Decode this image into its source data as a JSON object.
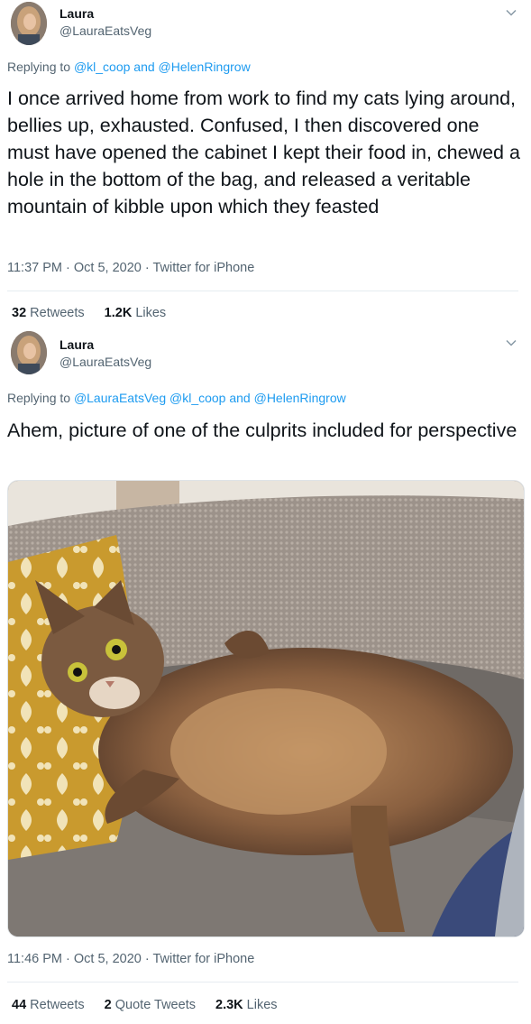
{
  "tweets": [
    {
      "name": "Laura",
      "handle": "@LauraEatsVeg",
      "reply_prefix": "Replying to",
      "reply_mentions": "@kl_coop and @HelenRingrow",
      "text": "I once arrived home from work to find my cats lying around, bellies up, exhausted. Confused, I then discovered one must have opened the cabinet I kept their food in, chewed a hole in the bottom of the bag, and released a veritable mountain of kibble upon which they feasted",
      "timestamp": "11:37 PM · Oct 5, 2020 · Twitter for iPhone",
      "retweets_count": "32",
      "retweets_label": "Retweets",
      "likes_count": "1.2K",
      "likes_label": "Likes"
    },
    {
      "name": "Laura",
      "handle": "@LauraEatsVeg",
      "reply_prefix": "Replying to",
      "reply_mentions": "@LauraEatsVeg @kl_coop and @HelenRingrow",
      "text": "Ahem, picture of one of the culprits included for perspective",
      "timestamp": "11:46 PM · Oct 5, 2020 · Twitter for iPhone",
      "retweets_count": "44",
      "retweets_label": "Retweets",
      "quote_count": "2",
      "quote_label": "Quote Tweets",
      "likes_count": "2.3K",
      "likes_label": "Likes"
    }
  ],
  "colors": {
    "link": "#1d9bf0",
    "secondary_text": "#536471",
    "primary_text": "#0f1419"
  },
  "icons": [
    "chevron-down-icon"
  ]
}
